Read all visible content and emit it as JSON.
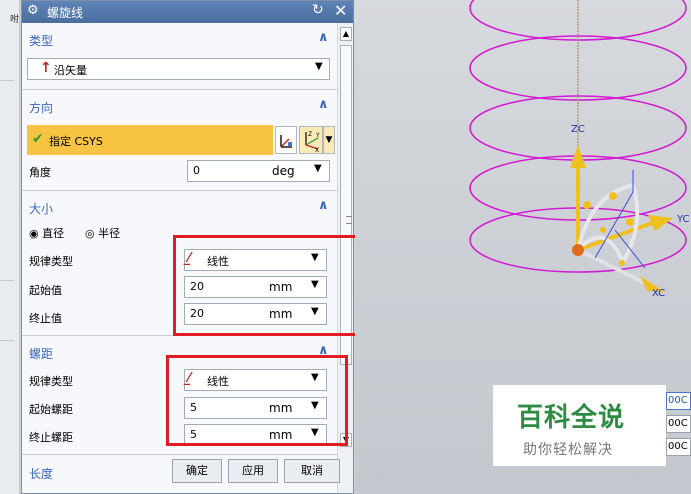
{
  "left_strip": {
    "text": "咐"
  },
  "dialog": {
    "title": "螺旋线",
    "sections": {
      "type": {
        "label": "类型",
        "selected": "沿矢量"
      },
      "direction": {
        "label": "方向",
        "csys_label": "指定 CSYS",
        "angle_label": "角度",
        "angle_value": "0",
        "angle_unit": "deg"
      },
      "size": {
        "label": "大小",
        "radio_diameter": "直径",
        "radio_radius": "半径",
        "law_type_label": "规律类型",
        "law_type_value": "线性",
        "start_label": "起始值",
        "start_value": "20",
        "start_unit": "mm",
        "end_label": "终止值",
        "end_value": "20",
        "end_unit": "mm"
      },
      "pitch": {
        "label": "螺距",
        "law_type_label": "规律类型",
        "law_type_value": "线性",
        "start_label": "起始螺距",
        "start_value": "5",
        "start_unit": "mm",
        "end_label": "终止螺距",
        "end_value": "5",
        "end_unit": "mm"
      },
      "length": {
        "label": "长度"
      }
    },
    "buttons": {
      "ok": "确定",
      "apply": "应用",
      "cancel": "取消"
    }
  },
  "viewport": {
    "axis_labels": {
      "zc": "ZC",
      "yc": "YC",
      "xc": "XC"
    },
    "coord_boxes": [
      "00C",
      "00C",
      "00C"
    ]
  },
  "watermark": {
    "title": "百科全说",
    "subtitle": "助你轻松解决"
  },
  "colors": {
    "helix": "#d21bd2",
    "highlight": "#f6c343",
    "section_label": "#3a66c4",
    "red_box": "#e21c24",
    "watermark_green": "#2e8b43"
  }
}
